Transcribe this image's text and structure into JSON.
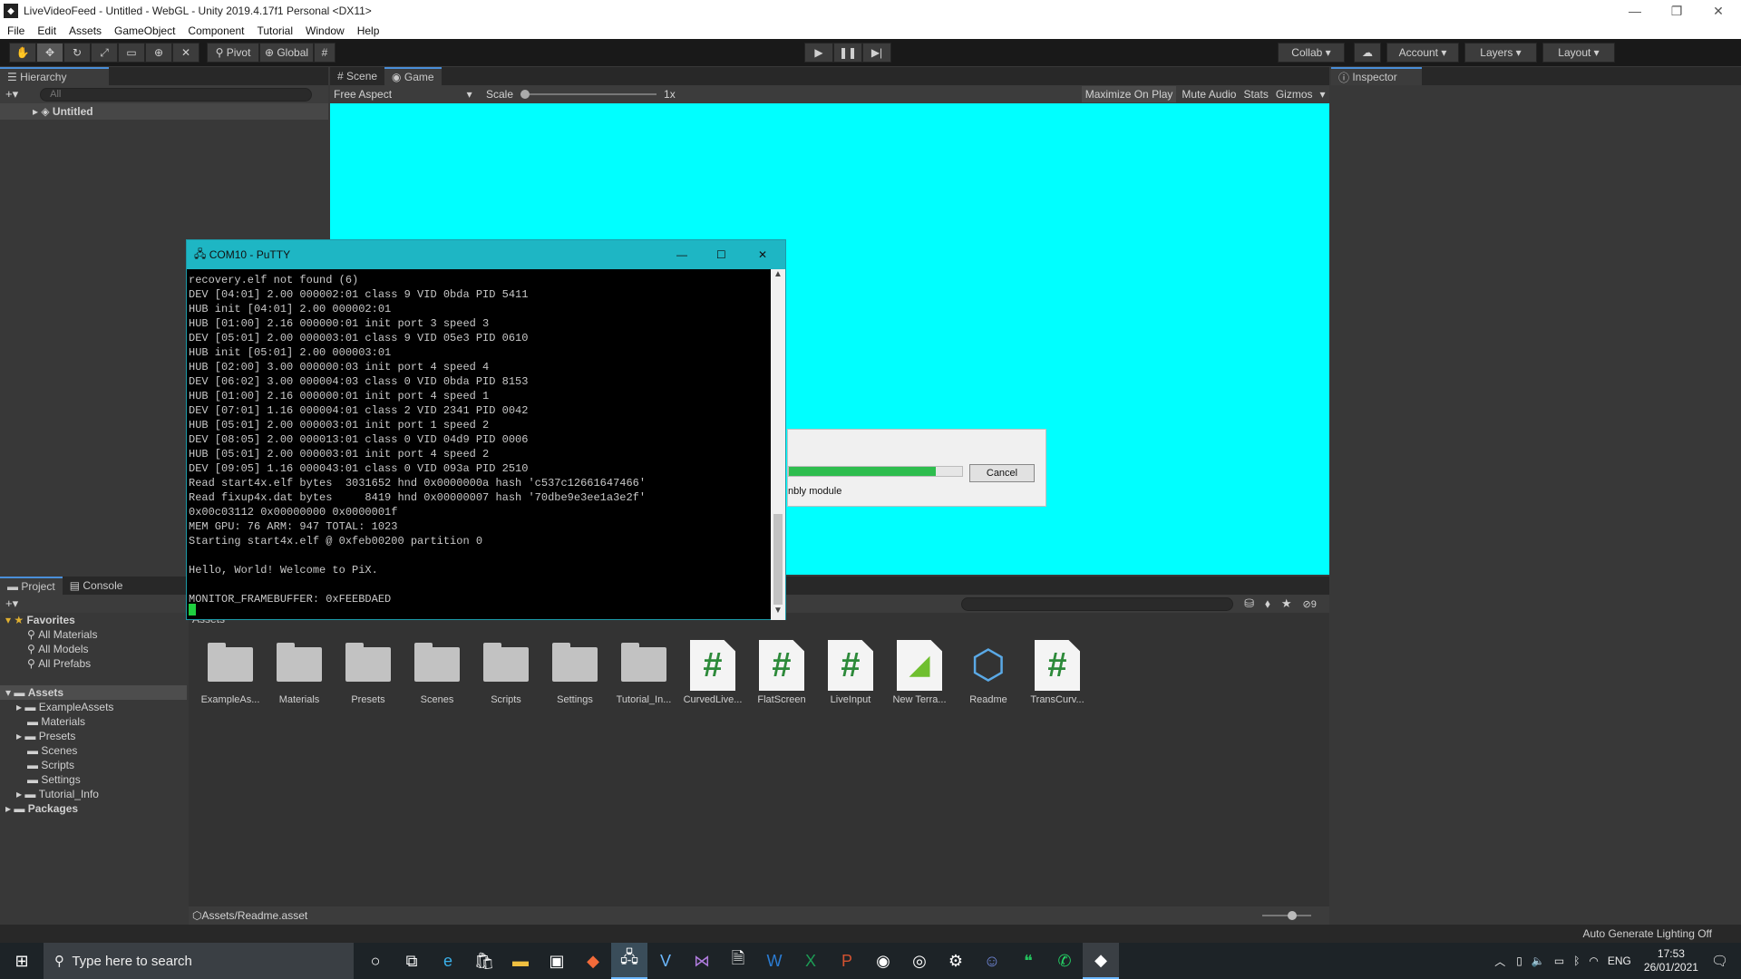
{
  "window": {
    "title": "LiveVideoFeed - Untitled - WebGL - Unity 2019.4.17f1 Personal <DX11>"
  },
  "menu": [
    "File",
    "Edit",
    "Assets",
    "GameObject",
    "Component",
    "Tutorial",
    "Window",
    "Help"
  ],
  "toolbar": {
    "pivot": "Pivot",
    "global": "Global",
    "collab": "Collab",
    "account": "Account",
    "layers": "Layers",
    "layout": "Layout"
  },
  "hierarchy": {
    "title": "Hierarchy",
    "search_placeholder": "All",
    "scene": "Untitled"
  },
  "view_tabs": {
    "scene": "Scene",
    "game": "Game"
  },
  "game_bar": {
    "aspect": "Free Aspect",
    "scale_label": "Scale",
    "scale_value": "1x",
    "maximize": "Maximize On Play",
    "mute": "Mute Audio",
    "stats": "Stats",
    "gizmos": "Gizmos"
  },
  "inspector": {
    "title": "Inspector"
  },
  "project_tabs": {
    "project": "Project",
    "console": "Console"
  },
  "project_tree": {
    "favorites": "Favorites",
    "fav_items": [
      "All Materials",
      "All Models",
      "All Prefabs"
    ],
    "assets": "Assets",
    "asset_items": [
      "ExampleAssets",
      "Materials",
      "Presets",
      "Scenes",
      "Scripts",
      "Settings",
      "Tutorial_Info"
    ],
    "packages": "Packages"
  },
  "assets_header": "Assets",
  "assets_grid": [
    {
      "label": "ExampleAs...",
      "kind": "folder"
    },
    {
      "label": "Materials",
      "kind": "folder"
    },
    {
      "label": "Presets",
      "kind": "folder"
    },
    {
      "label": "Scenes",
      "kind": "folder"
    },
    {
      "label": "Scripts",
      "kind": "folder"
    },
    {
      "label": "Settings",
      "kind": "folder"
    },
    {
      "label": "Tutorial_In...",
      "kind": "folder"
    },
    {
      "label": "CurvedLive...",
      "kind": "script"
    },
    {
      "label": "FlatScreen",
      "kind": "script"
    },
    {
      "label": "LiveInput",
      "kind": "script"
    },
    {
      "label": "New Terra...",
      "kind": "terrain"
    },
    {
      "label": "Readme",
      "kind": "readme"
    },
    {
      "label": "TransCurv...",
      "kind": "script"
    }
  ],
  "hidden_count": "9",
  "selected_path": "Assets/Readme.asset",
  "status": "Auto Generate Lighting Off",
  "putty": {
    "title": "COM10 - PuTTY",
    "lines": [
      "recovery.elf not found (6)",
      "DEV [04:01] 2.00 000002:01 class 9 VID 0bda PID 5411",
      "HUB init [04:01] 2.00 000002:01",
      "HUB [01:00] 2.16 000000:01 init port 3 speed 3",
      "DEV [05:01] 2.00 000003:01 class 9 VID 05e3 PID 0610",
      "HUB init [05:01] 2.00 000003:01",
      "HUB [02:00] 3.00 000000:03 init port 4 speed 4",
      "DEV [06:02] 3.00 000004:03 class 0 VID 0bda PID 8153",
      "HUB [01:00] 2.16 000000:01 init port 4 speed 1",
      "DEV [07:01] 1.16 000004:01 class 2 VID 2341 PID 0042",
      "HUB [05:01] 2.00 000003:01 init port 1 speed 2",
      "DEV [08:05] 2.00 000013:01 class 0 VID 04d9 PID 0006",
      "HUB [05:01] 2.00 000003:01 init port 4 speed 2",
      "DEV [09:05] 1.16 000043:01 class 0 VID 093a PID 2510",
      "Read start4x.elf bytes  3031652 hnd 0x0000000a hash 'c537c12661647466'",
      "Read fixup4x.dat bytes     8419 hnd 0x00000007 hash '70dbe9e3ee1a3e2f'",
      "0x00c03112 0x00000000 0x0000001f",
      "MEM GPU: 76 ARM: 947 TOTAL: 1023",
      "Starting start4x.elf @ 0xfeb00200 partition 0",
      "",
      "Hello, World! Welcome to PiX.",
      "",
      "MONITOR_FRAMEBUFFER: 0xFEEBDAED"
    ]
  },
  "progress": {
    "text": "nbly module",
    "cancel": "Cancel",
    "fraction": 0.85
  },
  "taskbar": {
    "search": "Type here to search",
    "lang": "ENG",
    "time": "17:53",
    "date": "26/01/2021"
  },
  "colors": {
    "game_bg": "#00ffff",
    "putty_title": "#1eb6c4",
    "progress": "#2ebd4e"
  }
}
